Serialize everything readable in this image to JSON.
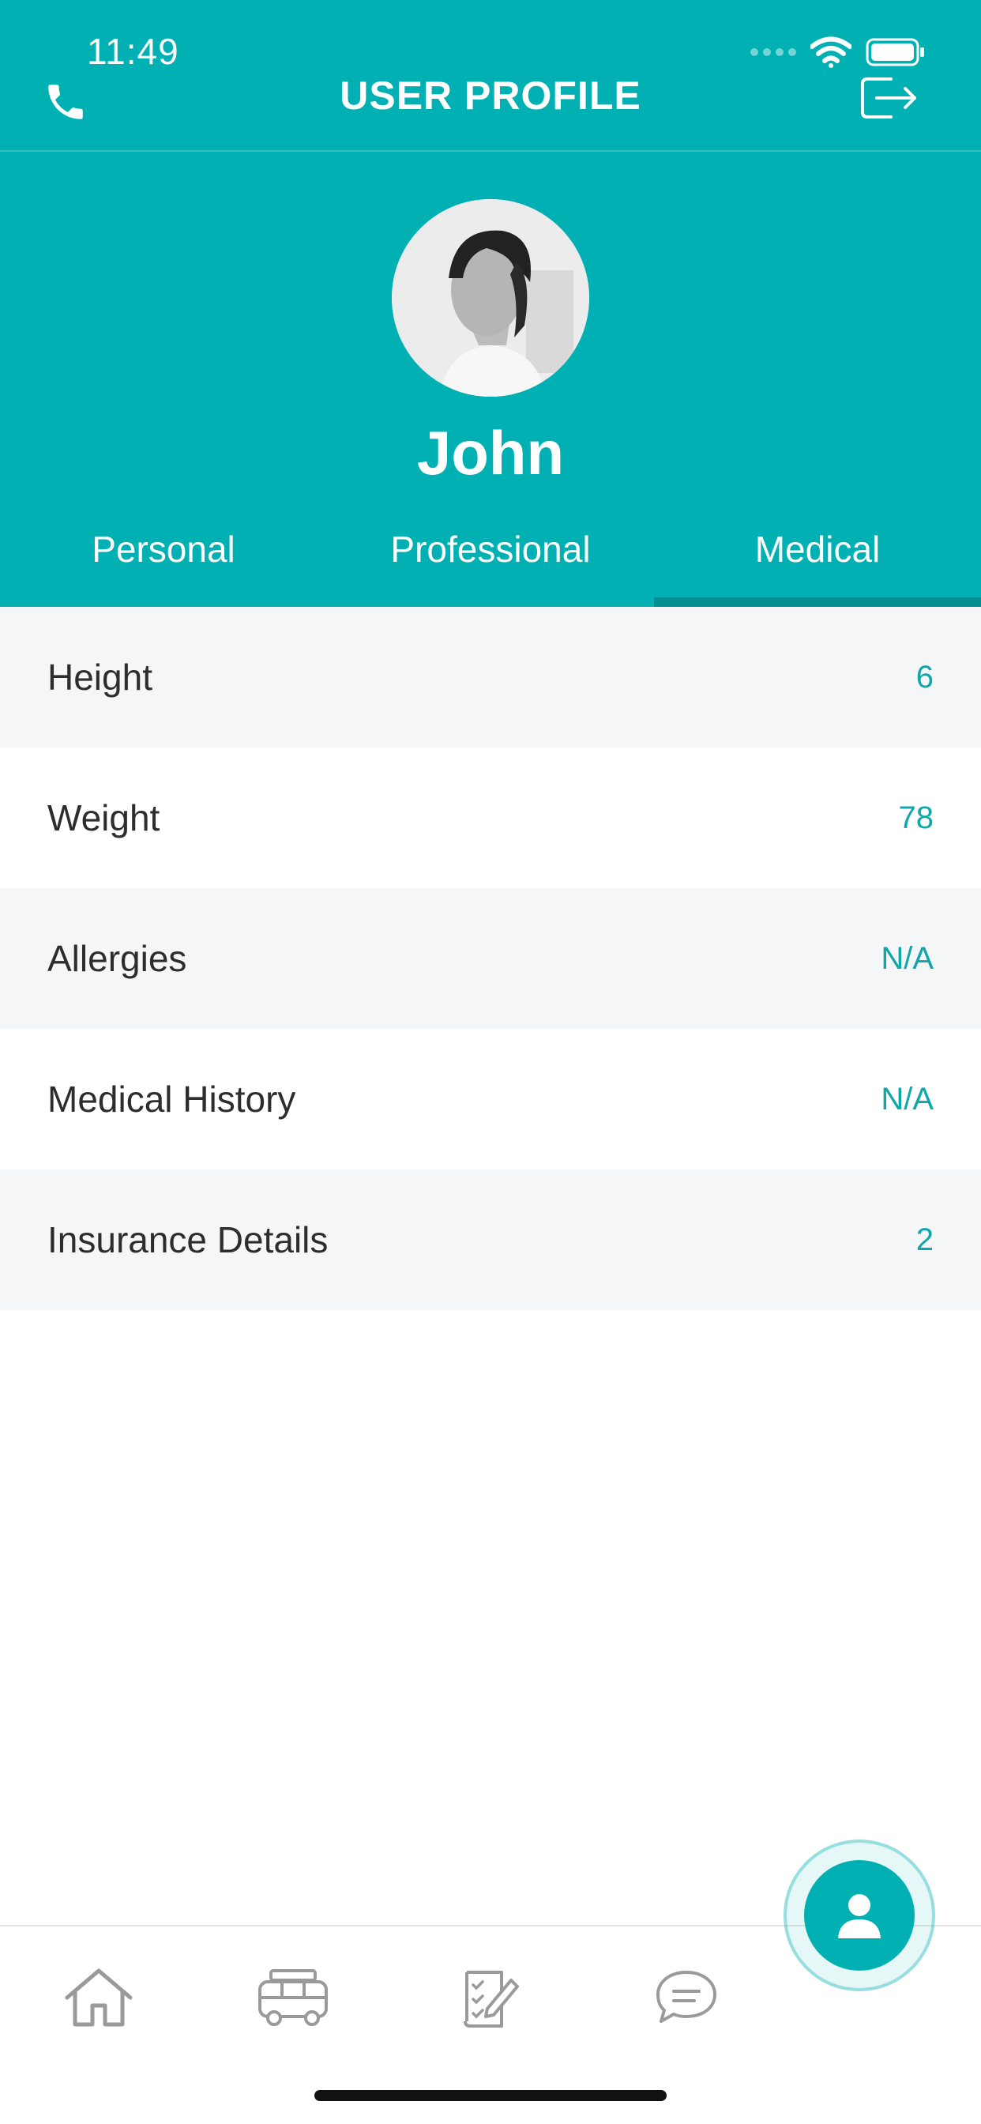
{
  "status_bar": {
    "time": "11:49",
    "icons": [
      "signal-icon",
      "wifi-icon",
      "battery-icon"
    ]
  },
  "topbar": {
    "title": "USER PROFILE",
    "left_icon": "phone-icon",
    "right_icon": "logout-icon"
  },
  "profile": {
    "name": "John",
    "avatar": "avatar-photo"
  },
  "tabs": [
    {
      "label": "Personal",
      "active": false
    },
    {
      "label": "Professional",
      "active": false
    },
    {
      "label": "Medical",
      "active": true
    }
  ],
  "medical_rows": [
    {
      "label": "Height",
      "value": "6"
    },
    {
      "label": "Weight",
      "value": "78"
    },
    {
      "label": "Allergies",
      "value": "N/A"
    },
    {
      "label": "Medical History",
      "value": "N/A"
    },
    {
      "label": "Insurance Details",
      "value": "2"
    }
  ],
  "bottom_nav": {
    "items": [
      "home-icon",
      "van-icon",
      "checklist-icon",
      "chat-icon"
    ],
    "fab_icon": "user-icon"
  },
  "colors": {
    "primary": "#00b0b3",
    "accent_value": "#10a7aa",
    "row_alt_bg": "#f5f6f8"
  }
}
